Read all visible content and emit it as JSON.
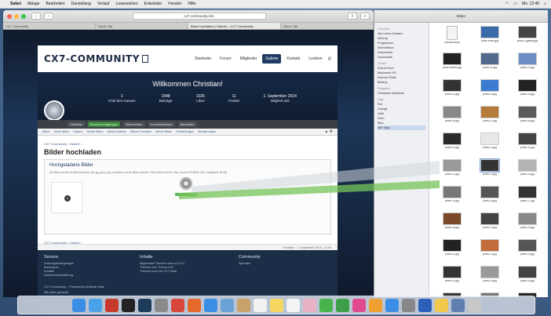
{
  "menubar": {
    "items": [
      "Safari",
      "Ablage",
      "Bearbeiten",
      "Darstellung",
      "Verlauf",
      "Lesezeichen",
      "Entwickler",
      "Fenster",
      "Hilfe"
    ],
    "right_text": "Mo. 12:45"
  },
  "browser": {
    "url": "cx7-community.info",
    "tabs": [
      "CX7 Community",
      "Neuer Tab",
      "Bilder hochladen | Galerie – CX7 Community",
      "Neuer Tab"
    ]
  },
  "site": {
    "logo": "CX7-COMMUNITY",
    "nav": [
      {
        "label": "Startseite"
      },
      {
        "label": "Forum"
      },
      {
        "label": "Mitglieder"
      },
      {
        "label": "Galerie"
      },
      {
        "label": "Kontakt"
      },
      {
        "label": "Lexikon"
      }
    ],
    "welcome": "Willkommen Christian!",
    "stats": [
      {
        "label": "Chef des Hauses",
        "value": "1"
      },
      {
        "label": "Beiträge",
        "value": "1948"
      },
      {
        "label": "Likes",
        "value": "1026"
      },
      {
        "label": "Punkte",
        "value": "11"
      },
      {
        "label": "Mitglied seit",
        "value": "1. September 2014"
      }
    ],
    "userbar": [
      "Christian",
      "Benachrichtigungen",
      "Nachrichten",
      "Kontrollzentrum",
      "Abmelden"
    ],
    "subnav": [
      "Alben",
      "Neue Alben",
      "Galerie",
      "Meine Alben",
      "Meine Dateien",
      "Meine Favoriten",
      "Meine Bilder",
      "Einstellungen",
      "Markierungen"
    ],
    "breadcrumb": "CX7 Community › Galerie ›",
    "page_title": "Bilder hochladen",
    "upload_heading": "Hochgeladene Bilder",
    "upload_desc": "Die Bilder werden für Benutzeralbum gilt: jpg, jpeg, png hochladen und die Bilder erstellen. Ziehe Bilder hierher. Max. Anzahl 200 Bilder. Max. Dateigröße 50 MB.",
    "pager": "CX7 Community › Galerie ›",
    "footer_meta": "Christian · 1. September 2014, 12:45",
    "footer": {
      "col1_title": "Service",
      "col1_items": [
        "Nutzungsbedingungen",
        "Impressum",
        "Kontakt",
        "Datenschutzerklärung"
      ],
      "col2_title": "Inhalte",
      "col2_items": [
        "Allgemeine Themen rund um CX7",
        "Themen zum Thema CX7",
        "Themen rund um CX7 Oldie"
      ],
      "col3_title": "Community",
      "col3_items": [
        "Spenden"
      ],
      "copyright": "CX7-Community – Powered by WoltLab Suite",
      "copyright2": "Mit Liebe gemacht"
    }
  },
  "finder": {
    "title": "Bilder",
    "sidebar_favorites_title": "Favoriten",
    "sidebar_favorites": [
      "Alle meine Dateien",
      "AirDrop",
      "Programme",
      "Schreibtisch",
      "Dokumente",
      "Downloads"
    ],
    "sidebar_devices_title": "Geräte",
    "sidebar_devices": [
      "iCloud Drive",
      "Macintosh HD",
      "Externe Platte",
      "Backup"
    ],
    "sidebar_shared_title": "Freigaben",
    "sidebar_shared": [
      "Christians MacBook"
    ],
    "sidebar_tags_title": "Tags",
    "sidebar_tags": [
      "Rot",
      "Orange",
      "Gelb",
      "Grün",
      "Blau",
      "Alle Tags …"
    ],
    "files": [
      {
        "name": "Dokument.pdf",
        "kind": "doc",
        "color": "#f4f4f4"
      },
      {
        "name": "photo-ecran.jpg",
        "kind": "img",
        "color": "#3a6aa8"
      },
      {
        "name": "photo-4-gallery.jpg",
        "kind": "img",
        "color": "#444"
      },
      {
        "name": "photo-screen.jpg",
        "kind": "img",
        "color": "#222"
      },
      {
        "name": "photo-01.jpg",
        "kind": "img",
        "color": "#516a8d"
      },
      {
        "name": "photo-02.jpg",
        "kind": "img",
        "color": "#6b8fc4"
      },
      {
        "name": "photo-03.jpg",
        "kind": "img",
        "color": "#333"
      },
      {
        "name": "photo-04.jpg",
        "kind": "img",
        "color": "#3b7bd0"
      },
      {
        "name": "photo-05.jpg",
        "kind": "img",
        "color": "#222"
      },
      {
        "name": "photo-06.jpg",
        "kind": "img",
        "color": "#888"
      },
      {
        "name": "photo-07.jpg",
        "kind": "img",
        "color": "#b47b3b"
      },
      {
        "name": "photo-08.jpg",
        "kind": "img",
        "color": "#5a5a5a"
      },
      {
        "name": "photo-09.jpg",
        "kind": "img",
        "color": "#2b2b2b"
      },
      {
        "name": "photo-10.jpg",
        "kind": "img",
        "color": "#e8e8e8"
      },
      {
        "name": "photo-11.jpg",
        "kind": "img",
        "color": "#444"
      },
      {
        "name": "photo-12.jpg",
        "kind": "img",
        "color": "#999"
      },
      {
        "name": "photo-13.jpg",
        "kind": "img",
        "color": "#333"
      },
      {
        "name": "photo-14.jpg",
        "kind": "img",
        "color": "#b3b3b3"
      },
      {
        "name": "photo-15.jpg",
        "kind": "img",
        "color": "#777"
      },
      {
        "name": "photo-16.jpg",
        "kind": "img",
        "color": "#555"
      },
      {
        "name": "photo-17.jpg",
        "kind": "img",
        "color": "#333"
      },
      {
        "name": "photo-18.jpg",
        "kind": "img",
        "color": "#7a4a2a"
      },
      {
        "name": "photo-19.jpg",
        "kind": "img",
        "color": "#444"
      },
      {
        "name": "photo-20.jpg",
        "kind": "img",
        "color": "#888"
      },
      {
        "name": "photo-21.jpg",
        "kind": "img",
        "color": "#222"
      },
      {
        "name": "photo-22.jpg",
        "kind": "img",
        "color": "#c26b3a"
      },
      {
        "name": "photo-23.jpg",
        "kind": "img",
        "color": "#555"
      },
      {
        "name": "photo-24.jpg",
        "kind": "img",
        "color": "#333"
      },
      {
        "name": "photo-25.jpg",
        "kind": "img",
        "color": "#999"
      },
      {
        "name": "photo-26.jpg",
        "kind": "img",
        "color": "#444"
      },
      {
        "name": "photo-27.jpg",
        "kind": "img",
        "color": "#333"
      },
      {
        "name": "photo-28.jpg",
        "kind": "img",
        "color": "#777"
      },
      {
        "name": "photo-29.jpg",
        "kind": "img",
        "color": "#222"
      }
    ]
  },
  "dock": {
    "icons": [
      {
        "name": "finder-icon",
        "color": "#3b8ee6"
      },
      {
        "name": "app-store-icon",
        "color": "#4aa3e8"
      },
      {
        "name": "filezilla-icon",
        "color": "#c6392b"
      },
      {
        "name": "terminal-icon",
        "color": "#222"
      },
      {
        "name": "photoshop-icon",
        "color": "#1e3b5a"
      },
      {
        "name": "rocket-icon",
        "color": "#8a8a8a"
      },
      {
        "name": "chrome-icon",
        "color": "#d8453a"
      },
      {
        "name": "firefox-icon",
        "color": "#e4692a"
      },
      {
        "name": "safari-icon",
        "color": "#3b8ee6"
      },
      {
        "name": "preview-icon",
        "color": "#6aa1d6"
      },
      {
        "name": "contacts-icon",
        "color": "#c9a26a"
      },
      {
        "name": "calendar-icon",
        "color": "#f2f2f2"
      },
      {
        "name": "notes-icon",
        "color": "#f6d860"
      },
      {
        "name": "reminders-icon",
        "color": "#f4f4f4"
      },
      {
        "name": "photos-icon",
        "color": "#e9b1c4"
      },
      {
        "name": "messages-icon",
        "color": "#47b34a"
      },
      {
        "name": "facetime-icon",
        "color": "#3d9f47"
      },
      {
        "name": "itunes-icon",
        "color": "#e04a8c"
      },
      {
        "name": "ibooks-icon",
        "color": "#f0a030"
      },
      {
        "name": "appstore2-icon",
        "color": "#3b8ee6"
      },
      {
        "name": "system-prefs-icon",
        "color": "#888"
      },
      {
        "name": "word-icon",
        "color": "#2b5fb8"
      },
      {
        "name": "quill-icon",
        "color": "#f2c94c"
      },
      {
        "name": "downloads-icon",
        "color": "#5f7fb0"
      },
      {
        "name": "trash-icon",
        "color": "#c8c8c8"
      }
    ]
  }
}
